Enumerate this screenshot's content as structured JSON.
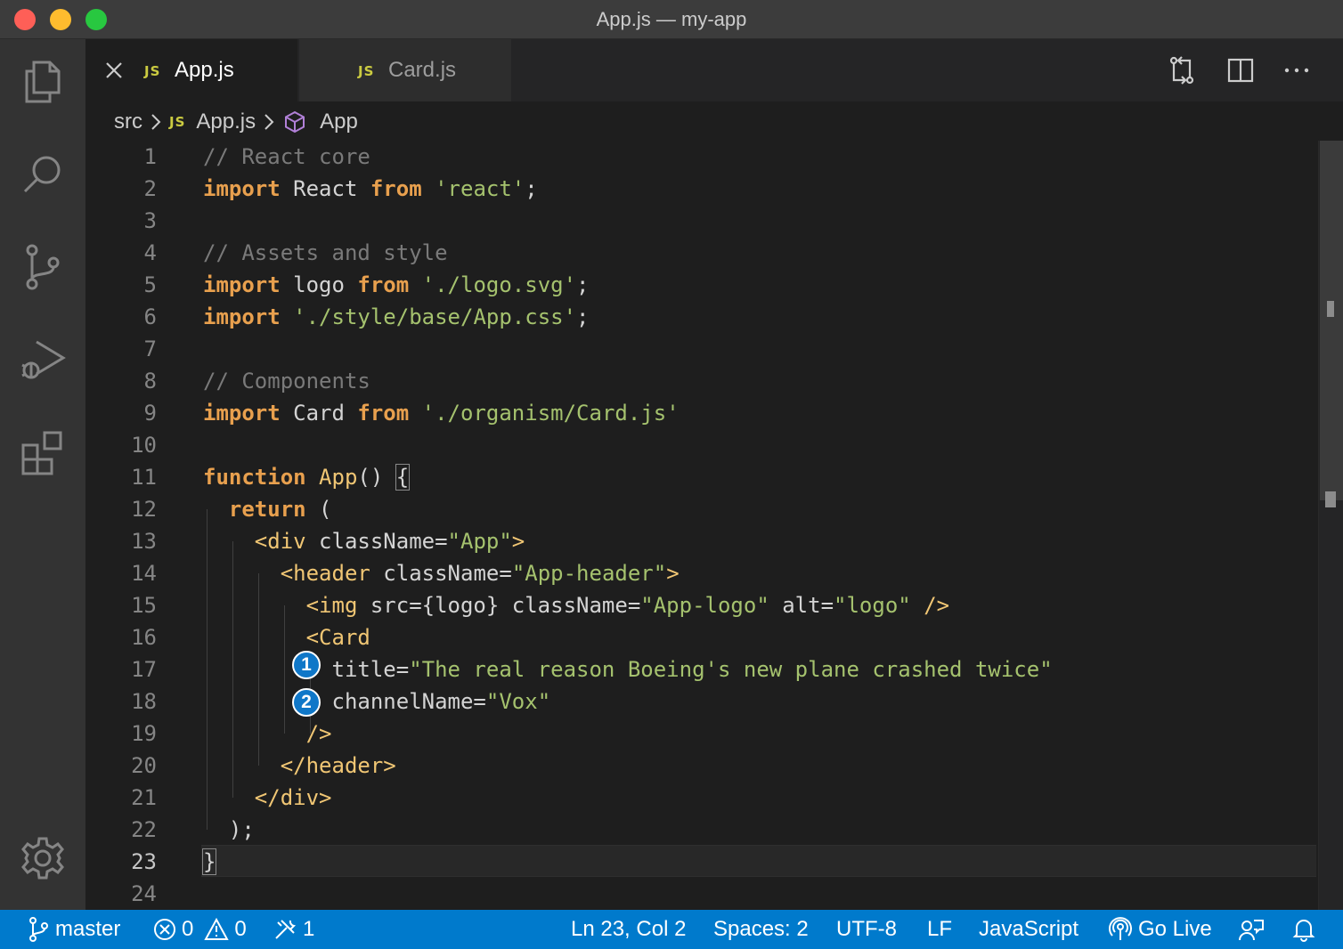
{
  "window": {
    "title": "App.js — my-app"
  },
  "activity_bar": {
    "items": [
      "explorer-icon",
      "search-icon",
      "source-control-icon",
      "run-debug-icon",
      "extensions-icon"
    ],
    "bottom": "settings-gear-icon"
  },
  "tabs": [
    {
      "badge": "JS",
      "label": "App.js",
      "active": true
    },
    {
      "badge": "JS",
      "label": "Card.js",
      "active": false
    }
  ],
  "breadcrumb": {
    "folder": "src",
    "file_badge": "JS",
    "file": "App.js",
    "symbol": "App"
  },
  "editor": {
    "current_line": 23,
    "lines": [
      {
        "n": "1",
        "text": "// React core"
      },
      {
        "n": "2",
        "text": "import React from 'react';"
      },
      {
        "n": "3",
        "text": ""
      },
      {
        "n": "4",
        "text": "// Assets and style"
      },
      {
        "n": "5",
        "text": "import logo from './logo.svg';"
      },
      {
        "n": "6",
        "text": "import './style/base/App.css';"
      },
      {
        "n": "7",
        "text": ""
      },
      {
        "n": "8",
        "text": "// Components"
      },
      {
        "n": "9",
        "text": "import Card from './organism/Card.js'"
      },
      {
        "n": "10",
        "text": ""
      },
      {
        "n": "11",
        "text": "function App() {"
      },
      {
        "n": "12",
        "text": "  return ("
      },
      {
        "n": "13",
        "text": "    <div className=\"App\">"
      },
      {
        "n": "14",
        "text": "      <header className=\"App-header\">"
      },
      {
        "n": "15",
        "text": "        <img src={logo} className=\"App-logo\" alt=\"logo\" />"
      },
      {
        "n": "16",
        "text": "        <Card"
      },
      {
        "n": "17",
        "text": "          title=\"The real reason Boeing's new plane crashed twice\""
      },
      {
        "n": "18",
        "text": "          channelName=\"Vox\""
      },
      {
        "n": "19",
        "text": "        />"
      },
      {
        "n": "20",
        "text": "      </header>"
      },
      {
        "n": "21",
        "text": "    </div>"
      },
      {
        "n": "22",
        "text": "  );"
      },
      {
        "n": "23",
        "text": "}"
      },
      {
        "n": "24",
        "text": ""
      }
    ],
    "annotations": [
      {
        "label": "1",
        "line": 17
      },
      {
        "label": "2",
        "line": 18
      }
    ]
  },
  "status_bar": {
    "branch": "master",
    "errors": "0",
    "warnings": "0",
    "tools_count": "1",
    "cursor": "Ln 23, Col 2",
    "indent": "Spaces: 2",
    "encoding": "UTF-8",
    "eol": "LF",
    "language": "JavaScript",
    "go_live": "Go Live"
  },
  "colors": {
    "accent": "#007acc",
    "keyword": "#e8a04e",
    "string": "#a5c26e",
    "tag": "#f0c674",
    "comment": "#7a7a7a",
    "js_badge": "#cbcb41",
    "annotation": "#0f77c8"
  }
}
